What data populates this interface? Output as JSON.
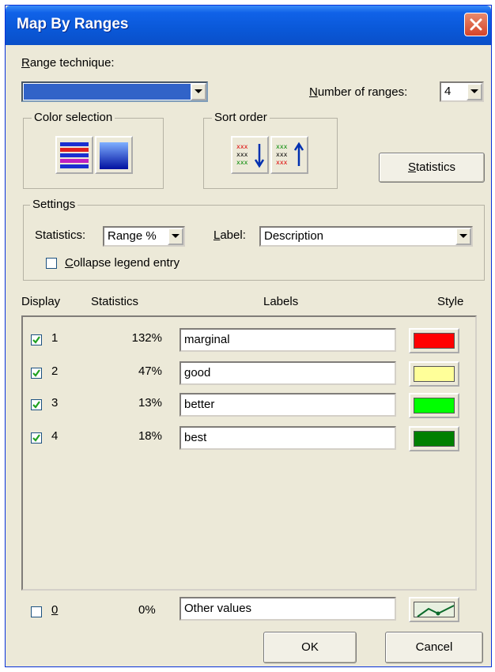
{
  "window": {
    "title": "Map By Ranges"
  },
  "range_technique": {
    "label_u": "R",
    "label_rest": "ange technique:",
    "value": ""
  },
  "number_of_ranges": {
    "label_u": "N",
    "label_rest": "umber of ranges:",
    "value": "4"
  },
  "color_selection": {
    "title": "Color selection"
  },
  "sort_order": {
    "title": "Sort order"
  },
  "statistics_button": {
    "label_u": "S",
    "label_rest": "tatistics"
  },
  "settings": {
    "title": "Settings",
    "statistics_label": "Statistics:",
    "statistics_value": "Range %",
    "label_u": "L",
    "label_rest": "abel:",
    "label_value": "Description",
    "collapse_u": "C",
    "collapse_rest": "ollapse legend entry",
    "collapse_checked": false
  },
  "columns": {
    "display": "Display",
    "statistics": "Statistics",
    "labels": "Labels",
    "style": "Style"
  },
  "ranges": [
    {
      "num": "1",
      "checked": true,
      "stat": "132%",
      "label": "marginal",
      "color": "#ff0000"
    },
    {
      "num": "2",
      "checked": true,
      "stat": "47%",
      "label": "good",
      "color": "#ffff99"
    },
    {
      "num": "3",
      "checked": true,
      "stat": "13%",
      "label": "better",
      "color": "#00ff00"
    },
    {
      "num": "4",
      "checked": true,
      "stat": "18%",
      "label": "best",
      "color": "#008000"
    }
  ],
  "other": {
    "num": "0",
    "checked": false,
    "stat": "0%",
    "label": "Other values"
  },
  "buttons": {
    "ok": "OK",
    "cancel": "Cancel"
  },
  "colors": {
    "titlebar": "#0a58d8",
    "dialog_bg": "#ece9d8",
    "range_combo_fill": "#3163c8"
  }
}
